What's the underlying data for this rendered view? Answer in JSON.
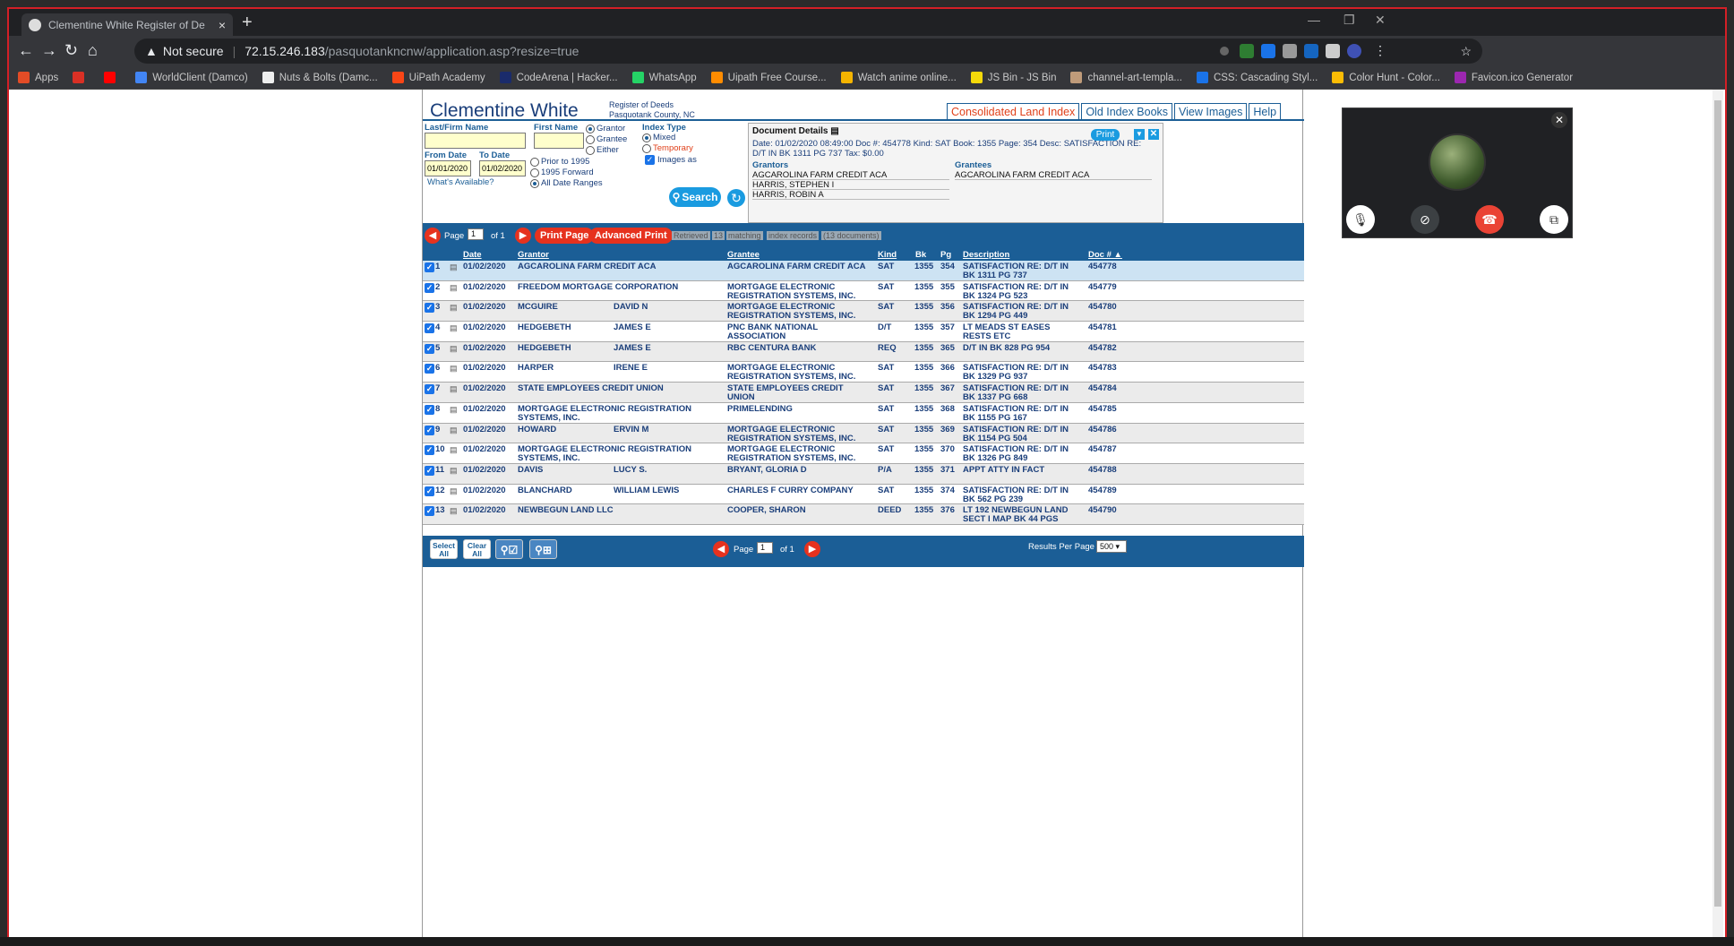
{
  "browser": {
    "tab_title": "Clementine White  Register of De",
    "tab_close": "×",
    "new_tab": "+",
    "url_warning": "Not secure",
    "url_host": "72.15.246.183",
    "url_path": "/pasquotankncnw/application.asp?resize=true",
    "bookmarks": [
      {
        "label": "Apps",
        "color": "#e34c26"
      },
      {
        "label": "",
        "color": "#d93025"
      },
      {
        "label": "",
        "color": "#ff0000"
      },
      {
        "label": "WorldClient (Damco)",
        "color": "#4285f4"
      },
      {
        "label": "Nuts & Bolts (Damc...",
        "color": "#eeeeee"
      },
      {
        "label": "UiPath Academy",
        "color": "#fa4616"
      },
      {
        "label": "CodeArena | Hacker...",
        "color": "#1a2b6b"
      },
      {
        "label": "WhatsApp",
        "color": "#25d366"
      },
      {
        "label": "Uipath Free Course...",
        "color": "#ff8c00"
      },
      {
        "label": "Watch anime online...",
        "color": "#f4b400"
      },
      {
        "label": "JS Bin - JS Bin",
        "color": "#f5d90a"
      },
      {
        "label": "channel-art-templa...",
        "color": "#bf9b7a"
      },
      {
        "label": "CSS: Cascading Styl...",
        "color": "#1a73e8"
      },
      {
        "label": "Color Hunt - Color...",
        "color": "#fbbc05"
      },
      {
        "label": "Favicon.ico Generator",
        "color": "#9c27b0"
      }
    ]
  },
  "header": {
    "name": "Clementine White",
    "sub1": "Register of Deeds",
    "sub2": "Pasquotank County, NC",
    "tabs": [
      "Consolidated Land Index",
      "Old Index Books",
      "View Images",
      "Help"
    ]
  },
  "search": {
    "last_label": "Last/Firm Name",
    "first_label": "First Name",
    "party_options": [
      "Grantor",
      "Grantee",
      "Either"
    ],
    "index_type_label": "Index Type",
    "index_options": [
      "Mixed",
      "Temporary"
    ],
    "images_label": "Images as",
    "from_label": "From Date",
    "to_label": "To Date",
    "from_value": "01/01/2020",
    "to_value": "01/02/2020",
    "range_options": [
      "Prior to 1995",
      "1995 Forward",
      "All Date Ranges"
    ],
    "available_link": "What's Available?",
    "search_button": "Search"
  },
  "doc_details": {
    "title": "Document Details",
    "print": "Print",
    "meta": "Date: 01/02/2020 08:49:00 Doc #: 454778 Kind: SAT Book: 1355 Page: 354 Desc: SATISFACTION RE: D/T IN BK 1311 PG 737 Tax: $0.00",
    "grantors_label": "Grantors",
    "grantors": [
      "AGCAROLINA FARM CREDIT ACA",
      "HARRIS, STEPHEN I",
      "HARRIS, ROBIN A"
    ],
    "grantees_label": "Grantees",
    "grantees": [
      "AGCAROLINA FARM CREDIT ACA"
    ]
  },
  "pager": {
    "page_label": "Page",
    "page_value": "1",
    "of_label": "of 1",
    "print_page": "Print Page",
    "advanced_print": "Advanced Print",
    "stats": [
      "Retrieved",
      "13",
      "matching",
      "index records",
      "(13 documents)"
    ]
  },
  "columns": [
    "Date",
    "Grantor",
    "Grantee",
    "Kind",
    "Bk",
    "Pg",
    "Description",
    "Doc # ▲"
  ],
  "rows": [
    {
      "n": "1",
      "date": "01/02/2020",
      "g1": "AGCAROLINA FARM CREDIT ACA",
      "g2": "",
      "grantee": "AGCAROLINA FARM CREDIT ACA",
      "kind": "SAT",
      "bk": "1355",
      "pg": "354",
      "desc": "SATISFACTION RE: D/T IN BK 1311 PG 737",
      "doc": "454778"
    },
    {
      "n": "2",
      "date": "01/02/2020",
      "g1": "FREEDOM MORTGAGE CORPORATION",
      "g2": "",
      "grantee": "MORTGAGE ELECTRONIC REGISTRATION SYSTEMS, INC.",
      "kind": "SAT",
      "bk": "1355",
      "pg": "355",
      "desc": "SATISFACTION RE: D/T IN BK 1324 PG 523",
      "doc": "454779"
    },
    {
      "n": "3",
      "date": "01/02/2020",
      "g1": "MCGUIRE",
      "g2": "DAVID N",
      "grantee": "MORTGAGE ELECTRONIC REGISTRATION SYSTEMS, INC.",
      "kind": "SAT",
      "bk": "1355",
      "pg": "356",
      "desc": "SATISFACTION RE: D/T IN BK 1294 PG 449",
      "doc": "454780"
    },
    {
      "n": "4",
      "date": "01/02/2020",
      "g1": "HEDGEBETH",
      "g2": "JAMES E",
      "grantee": "PNC BANK NATIONAL ASSOCIATION",
      "kind": "D/T",
      "bk": "1355",
      "pg": "357",
      "desc": "LT MEADS ST EASES RESTS ETC",
      "doc": "454781"
    },
    {
      "n": "5",
      "date": "01/02/2020",
      "g1": "HEDGEBETH",
      "g2": "JAMES E",
      "grantee": "RBC CENTURA BANK",
      "kind": "REQ",
      "bk": "1355",
      "pg": "365",
      "desc": "D/T IN BK 828 PG 954",
      "doc": "454782"
    },
    {
      "n": "6",
      "date": "01/02/2020",
      "g1": "HARPER",
      "g2": "IRENE E",
      "grantee": "MORTGAGE ELECTRONIC REGISTRATION SYSTEMS, INC.",
      "kind": "SAT",
      "bk": "1355",
      "pg": "366",
      "desc": "SATISFACTION RE: D/T IN BK 1329 PG 937",
      "doc": "454783"
    },
    {
      "n": "7",
      "date": "01/02/2020",
      "g1": "STATE EMPLOYEES CREDIT UNION",
      "g2": "",
      "grantee": "STATE EMPLOYEES CREDIT UNION",
      "kind": "SAT",
      "bk": "1355",
      "pg": "367",
      "desc": "SATISFACTION RE: D/T IN BK 1337 PG 668",
      "doc": "454784"
    },
    {
      "n": "8",
      "date": "01/02/2020",
      "g1": "MORTGAGE ELECTRONIC REGISTRATION SYSTEMS, INC.",
      "g2": "",
      "grantee": "PRIMELENDING",
      "kind": "SAT",
      "bk": "1355",
      "pg": "368",
      "desc": "SATISFACTION RE: D/T IN BK 1155 PG 167",
      "doc": "454785"
    },
    {
      "n": "9",
      "date": "01/02/2020",
      "g1": "HOWARD",
      "g2": "ERVIN M",
      "grantee": "MORTGAGE ELECTRONIC REGISTRATION SYSTEMS, INC.",
      "kind": "SAT",
      "bk": "1355",
      "pg": "369",
      "desc": "SATISFACTION RE: D/T IN BK 1154 PG 504",
      "doc": "454786"
    },
    {
      "n": "10",
      "date": "01/02/2020",
      "g1": "MORTGAGE ELECTRONIC REGISTRATION SYSTEMS, INC.",
      "g2": "",
      "grantee": "MORTGAGE ELECTRONIC REGISTRATION SYSTEMS, INC.",
      "kind": "SAT",
      "bk": "1355",
      "pg": "370",
      "desc": "SATISFACTION RE: D/T IN BK 1326 PG 849",
      "doc": "454787"
    },
    {
      "n": "11",
      "date": "01/02/2020",
      "g1": "DAVIS",
      "g2": "LUCY S.",
      "grantee": "BRYANT, GLORIA D",
      "kind": "P/A",
      "bk": "1355",
      "pg": "371",
      "desc": "APPT ATTY IN FACT",
      "doc": "454788"
    },
    {
      "n": "12",
      "date": "01/02/2020",
      "g1": "BLANCHARD",
      "g2": "WILLIAM LEWIS",
      "grantee": "CHARLES F CURRY COMPANY",
      "kind": "SAT",
      "bk": "1355",
      "pg": "374",
      "desc": "SATISFACTION RE: D/T IN BK 562 PG 239",
      "doc": "454789"
    },
    {
      "n": "13",
      "date": "01/02/2020",
      "g1": "NEWBEGUN LAND LLC",
      "g2": "",
      "grantee": "COOPER, SHARON",
      "kind": "DEED",
      "bk": "1355",
      "pg": "376",
      "desc": "LT 192 NEWBEGUN LAND SECT I MAP BK 44 PGS",
      "doc": "454790"
    }
  ],
  "footer": {
    "select_all": "Select All",
    "clear_all": "Clear All",
    "page_label": "Page",
    "page_value": "1",
    "of_label": "of 1",
    "rpp_label": "Results Per Page",
    "rpp_value": "500"
  },
  "colors": {
    "accent": "#1b5e96",
    "alert": "#e6321e",
    "button": "#1a9be0"
  }
}
